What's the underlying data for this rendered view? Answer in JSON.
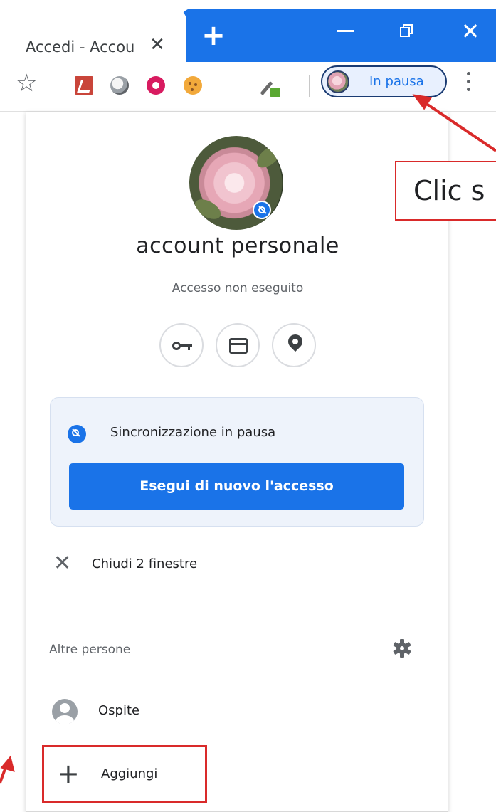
{
  "browser": {
    "tab": {
      "title": "Accedi - Accou",
      "close_glyph": "✕"
    },
    "new_tab_glyph": "+",
    "window_controls": {
      "close_glyph": "✕"
    },
    "accent_color": "#1a73e8"
  },
  "toolbar": {
    "bookmark_glyph": "☆",
    "profile_chip_label": "In pausa",
    "extensions": [
      "pdf-extension-icon",
      "globe-extension-icon",
      "donut-extension-icon",
      "cookie-extension-icon",
      "color-picker-extension-icon"
    ]
  },
  "profile_menu": {
    "name": "account personale",
    "status": "Accesso non eseguito",
    "quick_actions": [
      "key-icon",
      "card-icon",
      "location-pin-icon"
    ],
    "sync": {
      "message": "Sincronizzazione in pausa",
      "button_label": "Esegui di nuovo l'accesso"
    },
    "close_windows": {
      "glyph": "✕",
      "label": "Chiudi 2 finestre"
    },
    "other_people": {
      "heading": "Altre persone",
      "guest_label": "Ospite",
      "add_glyph": "+",
      "add_label": "Aggiungi"
    }
  },
  "annotations": {
    "callout_text": "Clic s",
    "highlight_color": "#d92a2a"
  }
}
